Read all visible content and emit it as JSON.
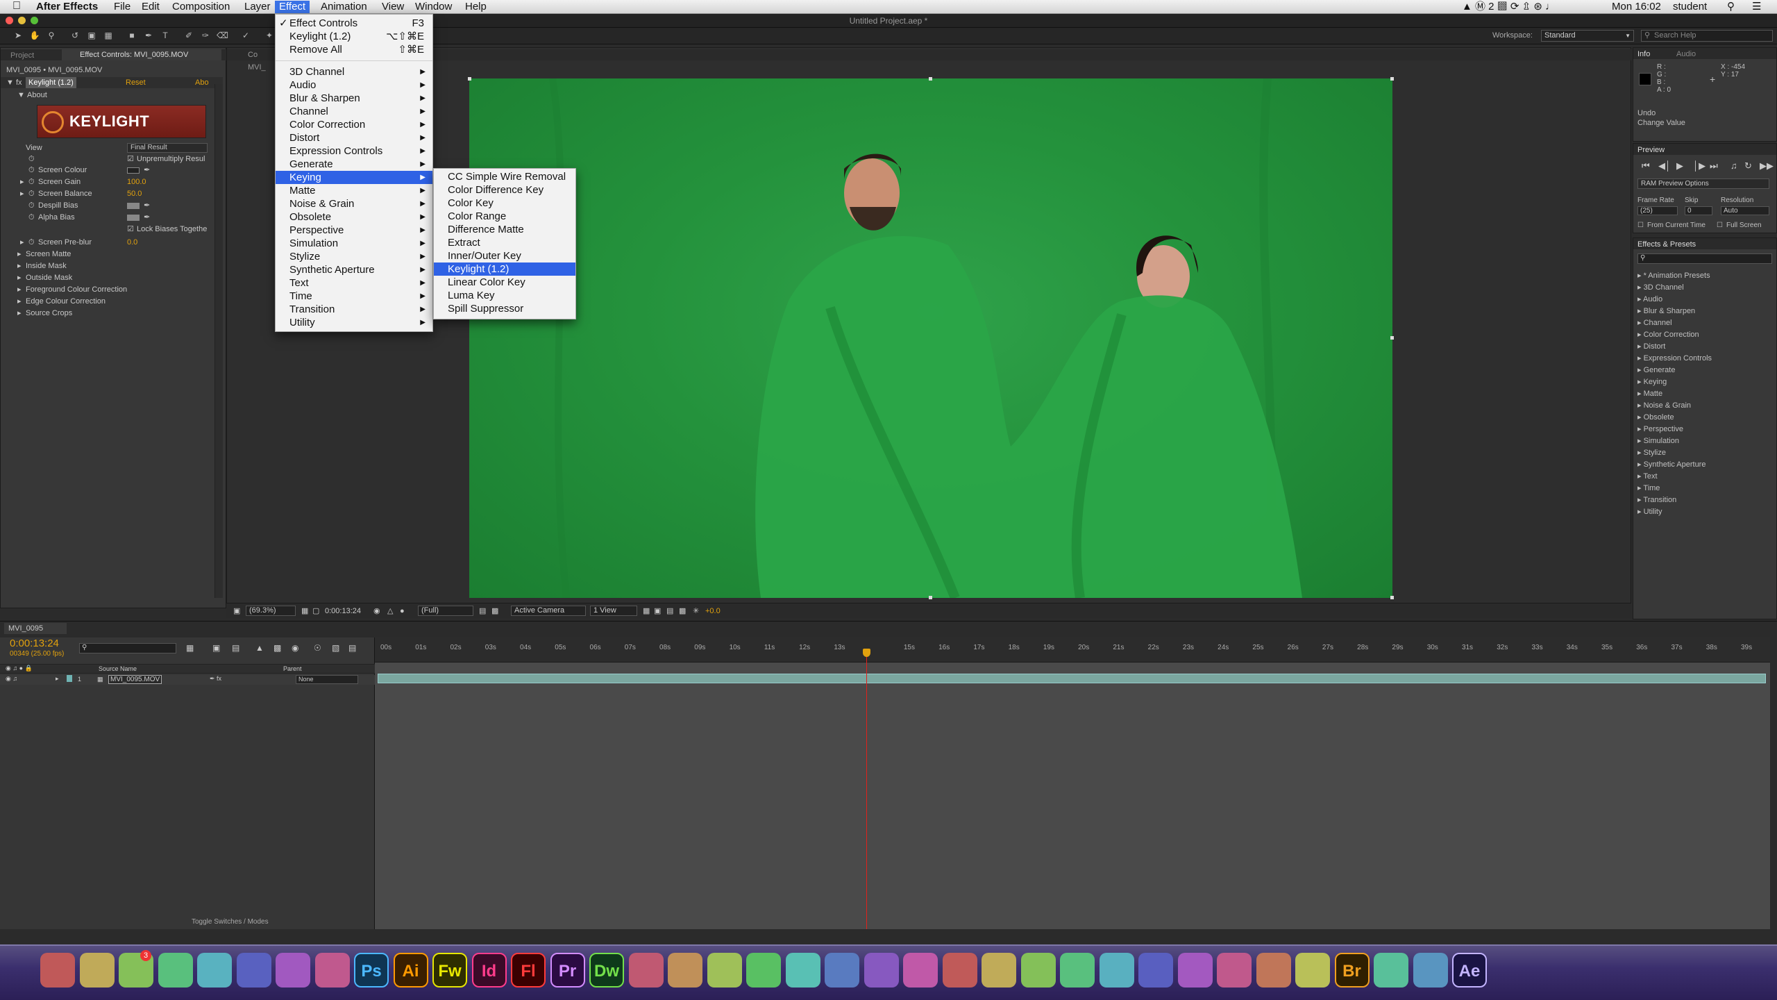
{
  "menubar": {
    "app": "After Effects",
    "items": [
      "File",
      "Edit",
      "Composition",
      "Layer",
      "Effect",
      "Animation",
      "View",
      "Window",
      "Help"
    ],
    "clock": "Mon 16:02",
    "user": "student"
  },
  "window_title": "Untitled Project.aep *",
  "workspace": {
    "label": "Workspace:",
    "value": "Standard",
    "search_placeholder": "Search Help"
  },
  "effect_panel": {
    "tabs": [
      "Project",
      "Effect Controls: MVI_0095.MOV"
    ],
    "layer_path": "MVI_0095 • MVI_0095.MOV",
    "effect_name": "Keylight (1.2)",
    "reset": "Reset",
    "about_short": "Abo",
    "about": "About",
    "logo": "KEYLIGHT",
    "view_label": "View",
    "view_value": "Final Result",
    "unpremultiply": "Unpremultiply Resul",
    "screen_colour": "Screen Colour",
    "screen_gain": "Screen Gain",
    "screen_gain_value": "100.0",
    "screen_balance": "Screen Balance",
    "screen_balance_value": "50.0",
    "despill_bias": "Despill Bias",
    "alpha_bias": "Alpha Bias",
    "lock_biases": "Lock Biases Togethe",
    "screen_preblur": "Screen Pre-blur",
    "screen_preblur_value": "0.0",
    "screen_matte": "Screen Matte",
    "inside_mask": "Inside Mask",
    "outside_mask": "Outside Mask",
    "fg_colour": "Foreground Colour Correction",
    "edge_colour": "Edge Colour Correction",
    "source_crops": "Source Crops"
  },
  "viewer": {
    "tab": "Co",
    "subtab": "MVI_",
    "zoom": "(69.3%)",
    "timecode": "0:00:13:24",
    "resolution": "(Full)",
    "camera": "Active Camera",
    "views": "1 View",
    "exposure": "+0.0"
  },
  "effect_menu": {
    "items": [
      {
        "label": "Effect Controls",
        "shortcut": "F3",
        "checked": true
      },
      {
        "label": "Keylight (1.2)",
        "shortcut": "⌥⇧⌘E"
      },
      {
        "label": "Remove All",
        "shortcut": "⇧⌘E"
      },
      {
        "label": "3D Channel"
      },
      {
        "label": "Audio"
      },
      {
        "label": "Blur & Sharpen"
      },
      {
        "label": "Channel"
      },
      {
        "label": "Color Correction"
      },
      {
        "label": "Distort"
      },
      {
        "label": "Expression Controls"
      },
      {
        "label": "Generate"
      },
      {
        "label": "Keying"
      },
      {
        "label": "Matte"
      },
      {
        "label": "Noise & Grain"
      },
      {
        "label": "Obsolete"
      },
      {
        "label": "Perspective"
      },
      {
        "label": "Simulation"
      },
      {
        "label": "Stylize"
      },
      {
        "label": "Synthetic Aperture"
      },
      {
        "label": "Text"
      },
      {
        "label": "Time"
      },
      {
        "label": "Transition"
      },
      {
        "label": "Utility"
      }
    ],
    "checkmark": "✓",
    "arrow": "▶"
  },
  "keying_menu": {
    "items": [
      "CC Simple Wire Removal",
      "Color Difference Key",
      "Color Key",
      "Color Range",
      "Difference Matte",
      "Extract",
      "Inner/Outer Key",
      "Keylight (1.2)",
      "Linear Color Key",
      "Luma Key",
      "Spill Suppressor"
    ]
  },
  "info_panel": {
    "tabs": [
      "Info",
      "Audio"
    ],
    "r": "R :",
    "g": "G :",
    "b": "B :",
    "a": "A : 0",
    "x": "X : -454",
    "y": "Y : 17",
    "undo": "Undo",
    "undo_value": "Change Value"
  },
  "preview_panel": {
    "tab": "Preview",
    "ram": "RAM Preview Options",
    "frame_rate": "Frame Rate",
    "skip": "Skip",
    "resolution": "Resolution",
    "frame_rate_value": "(25)",
    "skip_value": "0",
    "resolution_value": "Auto",
    "from_current": "From Current Time",
    "full_screen": "Full Screen"
  },
  "presets_panel": {
    "tab": "Effects & Presets",
    "items": [
      "* Animation Presets",
      "3D Channel",
      "Audio",
      "Blur & Sharpen",
      "Channel",
      "Color Correction",
      "Distort",
      "Expression Controls",
      "Generate",
      "Keying",
      "Matte",
      "Noise & Grain",
      "Obsolete",
      "Perspective",
      "Simulation",
      "Stylize",
      "Synthetic Aperture",
      "Text",
      "Time",
      "Transition",
      "Utility"
    ]
  },
  "timeline": {
    "tab": "MVI_0095",
    "timecode": "0:00:13:24",
    "frames": "00349 (25.00 fps)",
    "source_name": "Source Name",
    "parent": "Parent",
    "layer_num": "1",
    "layer_name": "MVI_0095.MOV",
    "parent_value": "None",
    "toggle": "Toggle Switches / Modes",
    "ticks": [
      "00s",
      "01s",
      "02s",
      "03s",
      "04s",
      "05s",
      "06s",
      "07s",
      "08s",
      "09s",
      "10s",
      "11s",
      "12s",
      "13s",
      "",
      "15s",
      "16s",
      "17s",
      "18s",
      "19s",
      "20s",
      "21s",
      "22s",
      "23s",
      "24s",
      "25s",
      "26s",
      "27s",
      "28s",
      "29s",
      "30s",
      "31s",
      "32s",
      "33s",
      "34s",
      "35s",
      "36s",
      "37s",
      "38s",
      "39s"
    ],
    "playhead_fraction": 0.357
  },
  "dock": {
    "icons": [
      "Finder",
      "Launchpad",
      "App Store",
      "Safari",
      "Firefox",
      "Preview",
      "iTunes",
      "iBooks",
      "Ps",
      "Ai",
      "Fw",
      "Id",
      "Fl",
      "Pr",
      "Dw",
      "Utility",
      "Xcode",
      "X11",
      "Unreal",
      "Unity",
      "Blender",
      "VLC",
      "GarageBand",
      "Keynote",
      "Numbers",
      "Pages",
      "Word",
      "Excel",
      "PowerPoint",
      "Camera",
      "Monitor",
      "Chess",
      "Automator",
      "Br",
      "Zoom",
      "Chrome",
      "Ae"
    ],
    "badge": "3"
  }
}
